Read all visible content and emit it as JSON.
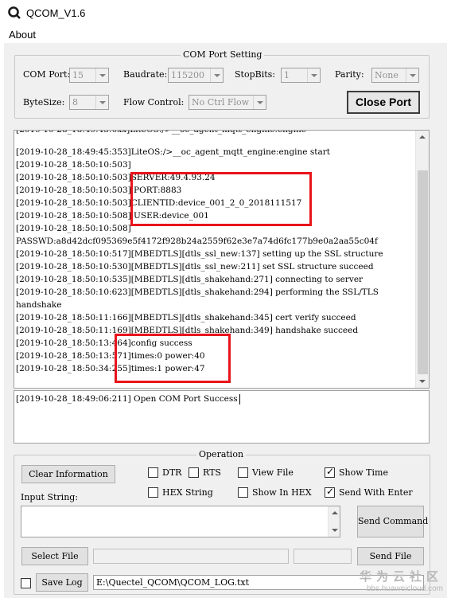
{
  "window": {
    "title": "QCOM_V1.6"
  },
  "menu": {
    "about": "About"
  },
  "com_port_setting": {
    "title": "COM Port Setting",
    "com_port_label": "COM Port:",
    "com_port_value": "15",
    "baudrate_label": "Baudrate:",
    "baudrate_value": "115200",
    "stopbits_label": "StopBits:",
    "stopbits_value": "1",
    "parity_label": "Parity:",
    "parity_value": "None",
    "bytesize_label": "ByteSize:",
    "bytesize_value": "8",
    "flow_control_label": "Flow Control:",
    "flow_control_value": "No Ctrl Flow",
    "close_port_label": "Close Port"
  },
  "log": {
    "lines": [
      "[2019-10-28_18:49:45:353]LiteOS:/>__oc_agent_mqtt_engine:engine start",
      "[2019-10-28_18:50:10:503]",
      "[2019-10-28_18:50:10:503]SERVER:49.4.93.24",
      "[2019-10-28_18:50:10:503] PORT:8883",
      "[2019-10-28_18:50:10:503]CLIENTID:device_001_2_0_2018111517",
      "[2019-10-28_18:50:10:508] USER:device_001",
      "[2019-10-28_18:50:10:508]",
      "PASSWD:a8d42dcf095369e5f4172f928b24a2559f62e3e7a74d6fc177b9e0a2aa55c04f",
      "[2019-10-28_18:50:10:517][MBEDTLS][dtls_ssl_new:137] setting up the SSL structure",
      "[2019-10-28_18:50:10:530][MBEDTLS][dtls_ssl_new:211] set SSL structure succeed",
      "[2019-10-28_18:50:10:535][MBEDTLS][dtls_shakehand:271] connecting to server",
      "[2019-10-28_18:50:10:623][MBEDTLS][dtls_shakehand:294] performing the SSL/TLS",
      "handshake",
      "[2019-10-28_18:50:11:166][MBEDTLS][dtls_shakehand:345] cert verify succeed",
      "[2019-10-28_18:50:11:169][MBEDTLS][dtls_shakehand:349] handshake succeed",
      "[2019-10-28_18:50:13:464]config success",
      "[2019-10-28_18:50:13:571]times:0 power:40",
      "[2019-10-28_18:50:34:255]times:1 power:47"
    ],
    "status_line": "[2019-10-28_18:49:06:211] Open COM Port Success"
  },
  "operation": {
    "title": "Operation",
    "clear_information": "Clear Information",
    "dtr": "DTR",
    "rts": "RTS",
    "view_file": "View File",
    "show_time": "Show Time",
    "hex_string": "HEX String",
    "show_in_hex": "Show In HEX",
    "send_with_enter": "Send With Enter",
    "input_string_label": "Input String:",
    "send_command": "Send Command",
    "select_file": "Select File",
    "send_file": "Send File",
    "save_log": "Save Log",
    "log_path": "E:\\Quectel_QCOM\\QCOM_LOG.txt",
    "checked": {
      "dtr": false,
      "rts": false,
      "view_file": false,
      "show_time": true,
      "hex_string": false,
      "show_in_hex": false,
      "send_with_enter": true,
      "save_log": false
    }
  },
  "watermark": {
    "cn": "华为云社区",
    "url": "bbs.huaweicloud.com"
  }
}
